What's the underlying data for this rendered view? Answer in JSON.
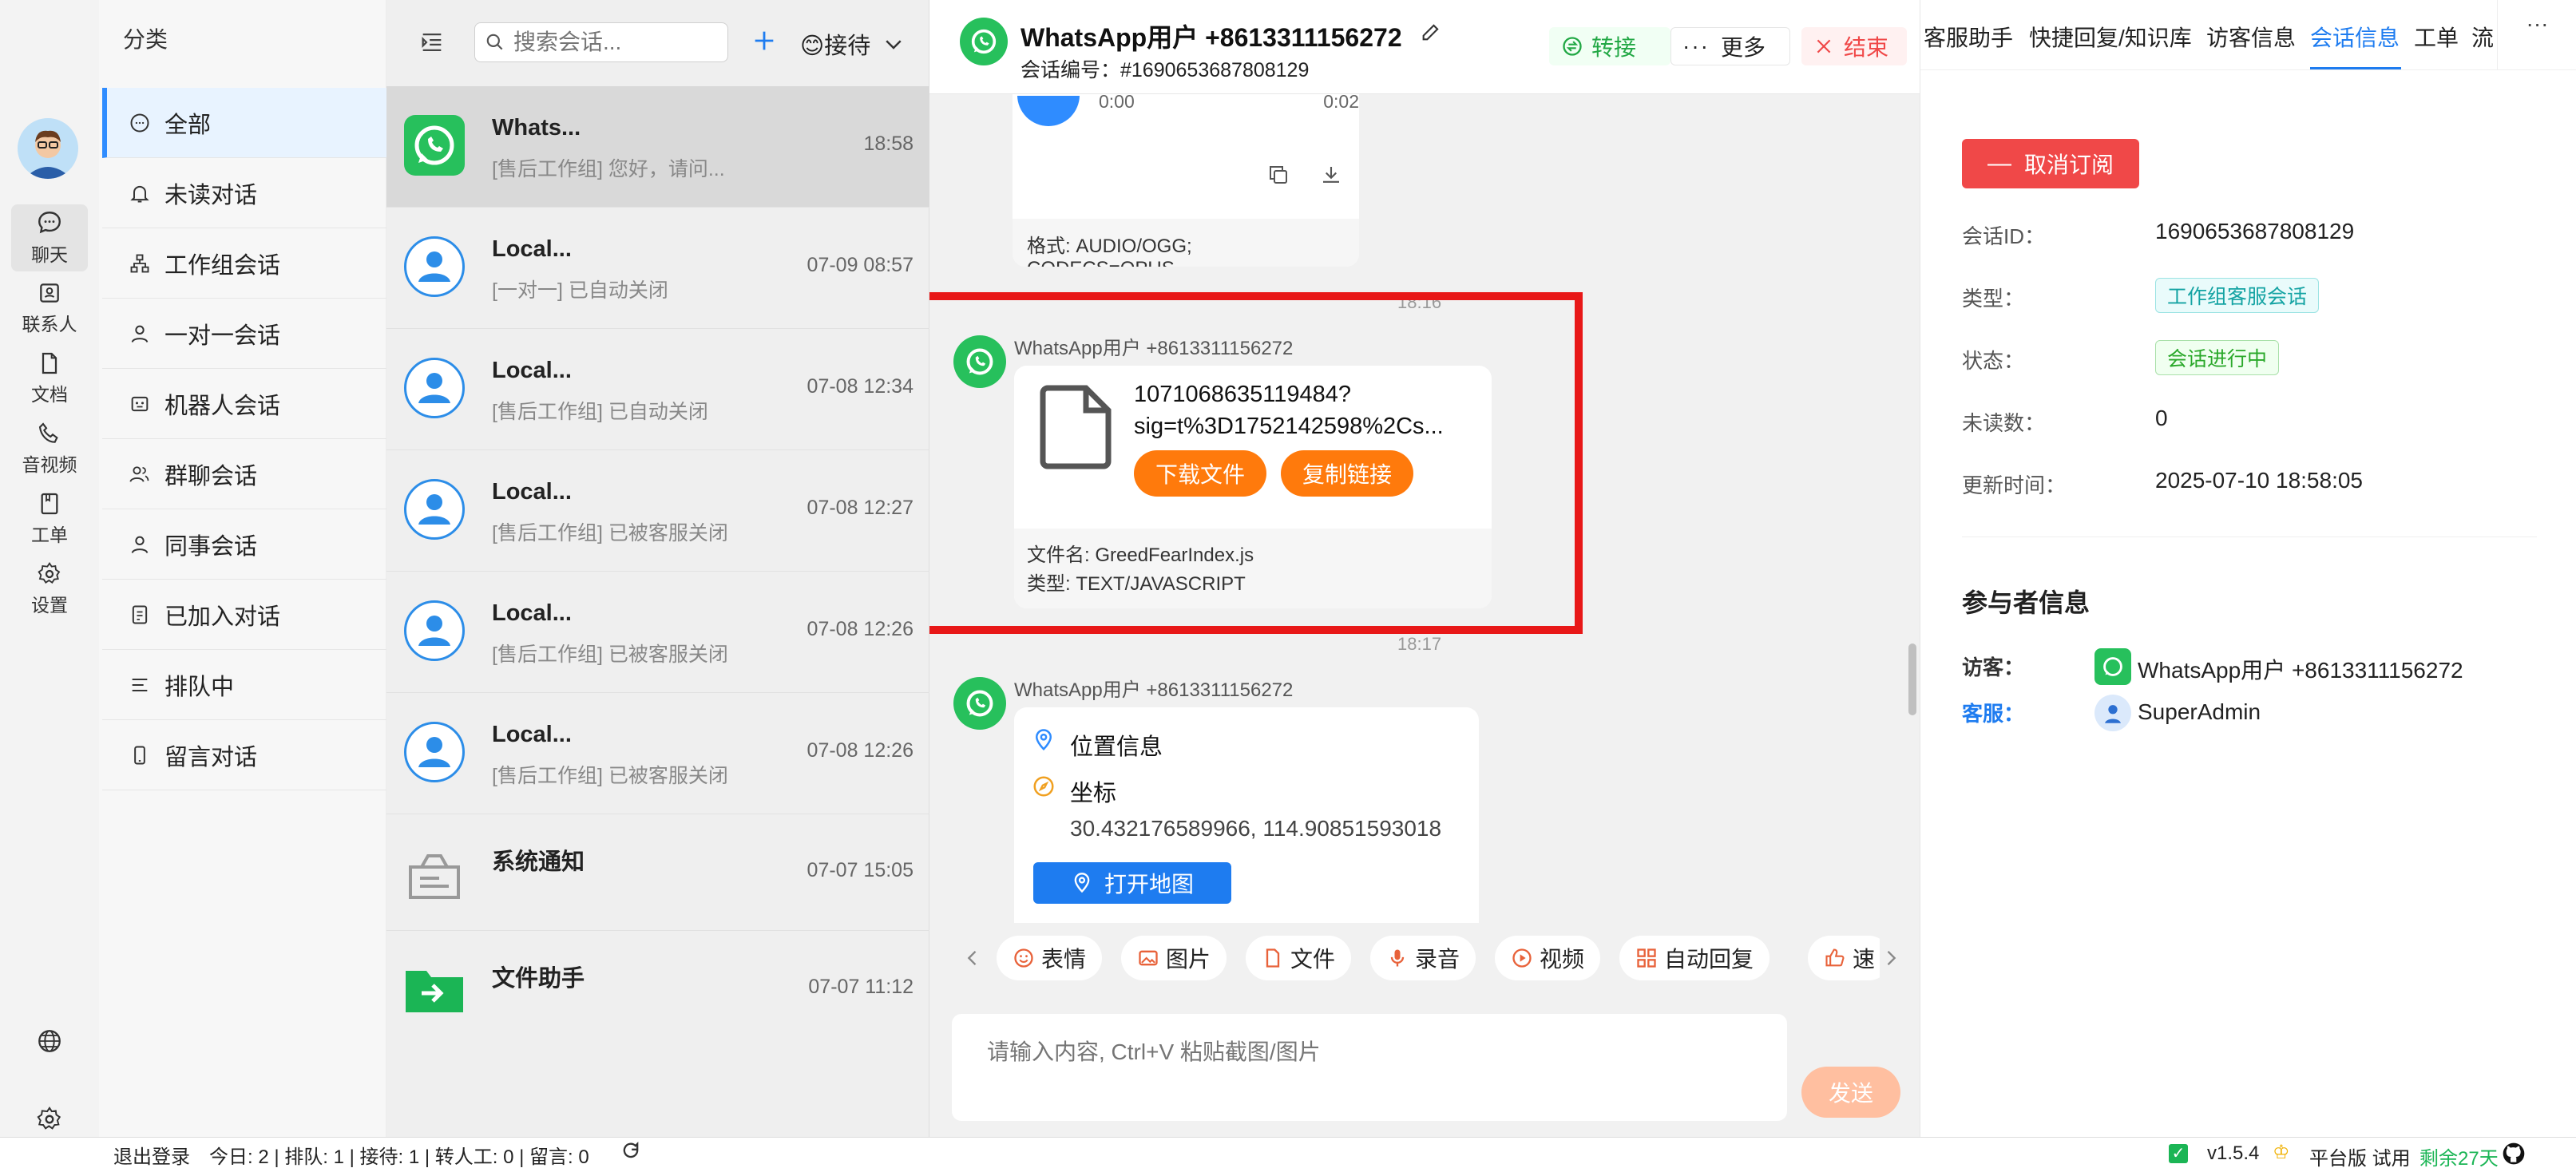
{
  "nav": {
    "items": [
      {
        "label": "聊天",
        "icon": "chat-icon",
        "active": true
      },
      {
        "label": "联系人",
        "icon": "contacts-icon"
      },
      {
        "label": "文档",
        "icon": "document-icon"
      },
      {
        "label": "音视频",
        "icon": "phone-icon"
      },
      {
        "label": "工单",
        "icon": "ticket-icon"
      },
      {
        "label": "设置",
        "icon": "gear-icon"
      }
    ],
    "bottom": [
      {
        "icon": "globe-icon"
      },
      {
        "icon": "settings-icon"
      }
    ]
  },
  "category": {
    "title": "分类",
    "items": [
      {
        "label": "全部",
        "icon": "chat-bubble-icon",
        "active": true
      },
      {
        "label": "未读对话",
        "icon": "bell-icon"
      },
      {
        "label": "工作组会话",
        "icon": "org-chart-icon"
      },
      {
        "label": "一对一会话",
        "icon": "user-icon"
      },
      {
        "label": "机器人会话",
        "icon": "robot-icon"
      },
      {
        "label": "群聊会话",
        "icon": "group-icon"
      },
      {
        "label": "同事会话",
        "icon": "colleague-icon"
      },
      {
        "label": "已加入对话",
        "icon": "joined-icon"
      },
      {
        "label": "排队中",
        "icon": "queue-icon"
      },
      {
        "label": "留言对话",
        "icon": "phone-message-icon"
      }
    ]
  },
  "conv_list": {
    "search_placeholder": "搜索会话...",
    "status_label": "😊接待",
    "items": [
      {
        "name": "Whats...",
        "preview": "[售后工作组] 您好，请问...",
        "time": "18:58",
        "avatar": "whatsapp",
        "active": true
      },
      {
        "name": "Local...",
        "preview": "[一对一] 已自动关闭",
        "time": "07-09 08:57",
        "avatar": "user"
      },
      {
        "name": "Local...",
        "preview": "[售后工作组] 已自动关闭",
        "time": "07-08 12:34",
        "avatar": "user"
      },
      {
        "name": "Local...",
        "preview": "[售后工作组] 已被客服关闭",
        "time": "07-08 12:27",
        "avatar": "user"
      },
      {
        "name": "Local...",
        "preview": "[售后工作组] 已被客服关闭",
        "time": "07-08 12:26",
        "avatar": "user"
      },
      {
        "name": "Local...",
        "preview": "[售后工作组] 已被客服关闭",
        "time": "07-08 12:26",
        "avatar": "user"
      },
      {
        "name": "系统通知",
        "preview": "",
        "time": "07-07 15:05",
        "avatar": "system"
      },
      {
        "name": "文件助手",
        "preview": "",
        "time": "07-07 11:12",
        "avatar": "file"
      }
    ]
  },
  "chat": {
    "title": "WhatsApp用户 +8613311156272",
    "session_no": "会话编号：#1690653687808129",
    "buttons": {
      "transfer": "转接",
      "more": "更多",
      "end": "结束"
    },
    "audio": {
      "start": "0:00",
      "end": "0:02",
      "format": "格式: AUDIO/OGG; CODECS=OPUS",
      "time_below": "18:16"
    },
    "file_msg": {
      "sender": "WhatsApp用户 +8613311156272",
      "line1": "1071068635119484?",
      "line2": "sig=t%3D1752142598%2Cs...",
      "download": "下载文件",
      "copy": "复制链接",
      "filename": "文件名: GreedFearIndex.js",
      "type": "类型: TEXT/JAVASCRIPT",
      "time_below": "18:17"
    },
    "location_msg": {
      "sender": "WhatsApp用户 +8613311156272",
      "title": "位置信息",
      "coord_label": "坐标",
      "coords": "30.432176589966, 114.90851593018",
      "open_map": "打开地图"
    },
    "tools": [
      "表情",
      "图片",
      "文件",
      "录音",
      "视频",
      "自动回复",
      "速"
    ],
    "input_placeholder": "请输入内容, Ctrl+V 粘贴截图/图片",
    "send": "发送"
  },
  "right": {
    "tabs": [
      "客服助手",
      "快捷回复/知识库",
      "访客信息",
      "会话信息",
      "工单",
      "流"
    ],
    "active_tab": 3,
    "unsubscribe": "取消订阅",
    "fields": [
      {
        "label": "会话ID：",
        "value": "1690653687808129"
      },
      {
        "label": "类型：",
        "value": "工作组客服会话"
      },
      {
        "label": "状态：",
        "value": "会话进行中"
      },
      {
        "label": "未读数：",
        "value": "0"
      },
      {
        "label": "更新时间：",
        "value": "2025-07-10 18:58:05"
      }
    ],
    "participants_title": "参与者信息",
    "visitor_label": "访客：",
    "visitor_name": "WhatsApp用户 +8613311156272",
    "agent_label": "客服：",
    "agent_name": "SuperAdmin"
  },
  "status_bar": {
    "logout": "退出登录",
    "stats": "今日: 2 | 排队: 1 | 接待: 1 | 转人工: 0 | 留言: 0",
    "version": "v1.5.4",
    "platform": "平台版 试用",
    "remaining": "剩余27天"
  },
  "colors": {
    "accent": "#1e7cf0",
    "whatsapp": "#27c05c",
    "orange": "#ff7a0c",
    "danger": "#f04848",
    "highlight_box": "#e81818"
  }
}
